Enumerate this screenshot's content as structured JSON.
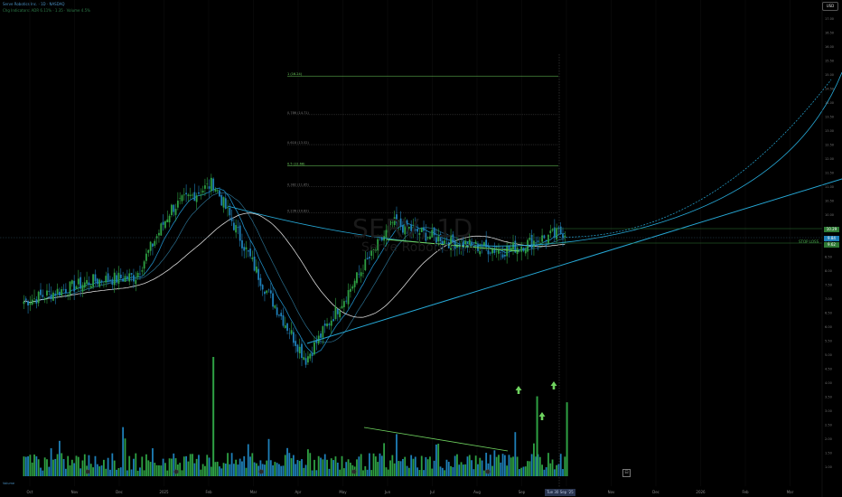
{
  "header": {
    "title_line": "Serve Robotics Inc. · 1D · NASDAQ",
    "sub_line": "Chg Indicators: ADR 6.11% · 1.35 · Volume 4.5%"
  },
  "watermark": {
    "ticker": "SERV, 1D",
    "company": "Serve Robotics Inc."
  },
  "currency_label": "USD",
  "colors": {
    "up": "#2ea043",
    "down": "#1e7fb8",
    "ema_fast": "#1e8bc3",
    "sma_slow": "#d8d8d8",
    "trend": "#26a8d6",
    "fib": "#6fd35f"
  },
  "fib_levels": [
    {
      "label": "1 (16.24)",
      "price": 16.24,
      "highlight": true
    },
    {
      "label": "0.786 (14.71)",
      "price": 14.71,
      "highlight": false
    },
    {
      "label": "0.618 (13.52)",
      "price": 13.52,
      "highlight": false
    },
    {
      "label": "0.5 (12.68)",
      "price": 12.68,
      "highlight": true
    },
    {
      "label": "0.382 (11.85)",
      "price": 11.85,
      "highlight": false
    },
    {
      "label": "0.236 (10.82)",
      "price": 10.82,
      "highlight": false
    }
  ],
  "price_axis_ticks": [
    "17.00",
    "16.50",
    "16.00",
    "15.50",
    "15.00",
    "14.50",
    "14.00",
    "13.50",
    "13.00",
    "12.50",
    "12.00",
    "11.50",
    "11.00",
    "10.50",
    "10.00",
    "9.50",
    "9.00",
    "8.50",
    "8.00",
    "7.50",
    "7.00",
    "6.50",
    "6.00",
    "5.50",
    "5.00",
    "4.50",
    "4.00",
    "3.50",
    "3.00",
    "2.50",
    "2.00",
    "1.50",
    "1.00"
  ],
  "current_price": {
    "value": "9.84",
    "color": "#1e7fb8"
  },
  "stop_loss": {
    "label": "STOP LOSS",
    "value": "9.62"
  },
  "resistance": {
    "value": "10.29"
  },
  "time_axis": [
    "Oct",
    "Nov",
    "Dec",
    "2025",
    "Feb",
    "Mar",
    "Apr",
    "May",
    "Jun",
    "Jul",
    "Aug",
    "Sep",
    "Oct",
    "Nov",
    "Dec",
    "2026",
    "Feb",
    "Mar"
  ],
  "current_date": "Tue 30 Sep '25",
  "volume_label": "Volume",
  "chart_data": {
    "type": "candlestick",
    "title": "SERV, 1D",
    "ylim": [
      4.2,
      17.6
    ],
    "x_range": [
      "2024-09-15",
      "2026-03-20"
    ],
    "swing_points": [
      {
        "date": "2024-10-01",
        "close": 7.3
      },
      {
        "date": "2024-11-15",
        "close": 8.1
      },
      {
        "date": "2024-12-15",
        "close": 8.3
      },
      {
        "date": "2025-01-08",
        "close": 11.0
      },
      {
        "date": "2025-02-05",
        "close": 12.0
      },
      {
        "date": "2025-03-10",
        "close": 8.0
      },
      {
        "date": "2025-04-08",
        "close": 5.0
      },
      {
        "date": "2025-05-15",
        "close": 8.5
      },
      {
        "date": "2025-06-05",
        "close": 10.4
      },
      {
        "date": "2025-07-10",
        "close": 9.7
      },
      {
        "date": "2025-08-18",
        "close": 9.3
      },
      {
        "date": "2025-09-30",
        "close": 10.1
      }
    ],
    "volume_spikes": [
      {
        "date": "2025-02-05",
        "relative": 1.0
      },
      {
        "date": "2025-09-10",
        "relative": 0.67
      },
      {
        "date": "2025-09-30",
        "relative": 0.62
      }
    ]
  }
}
